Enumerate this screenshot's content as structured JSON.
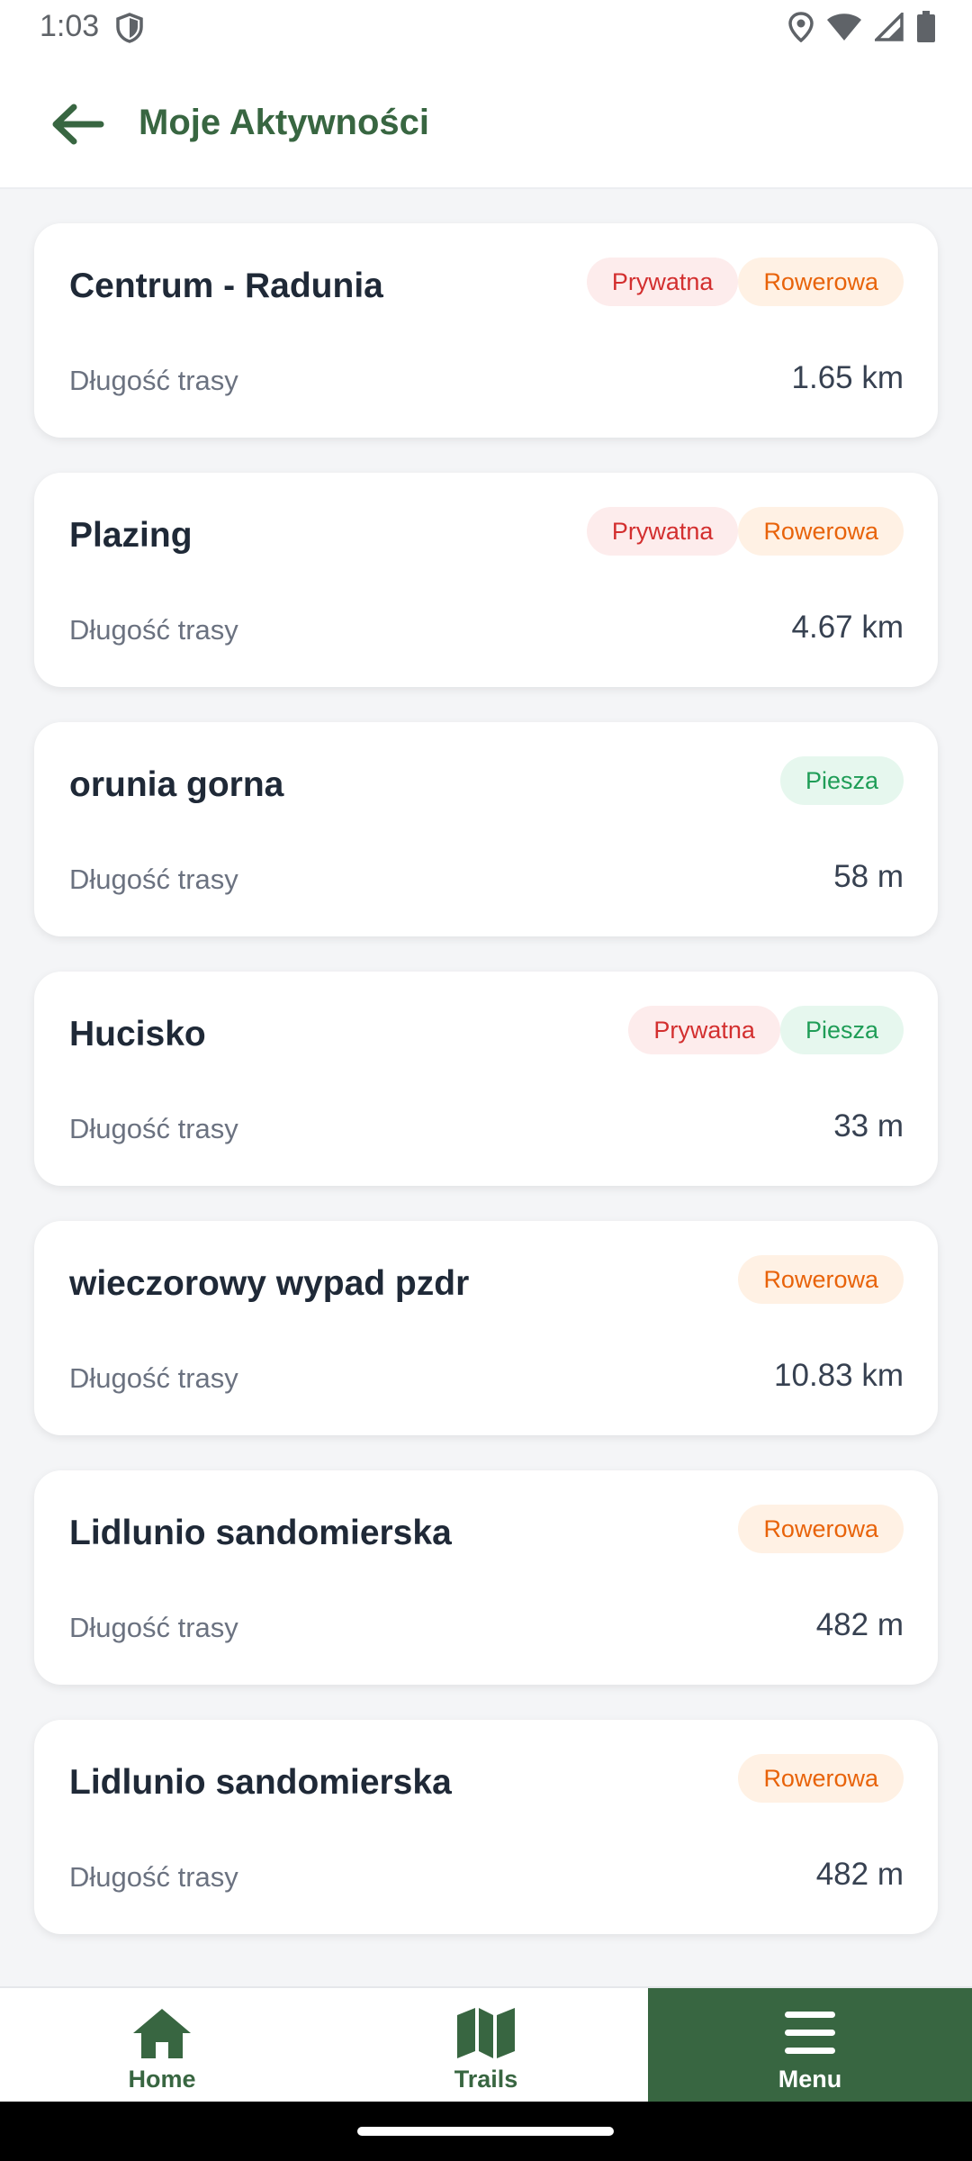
{
  "status_bar": {
    "time": "1:03",
    "icons": [
      "shield-icon",
      "location-icon",
      "wifi-icon",
      "signal-icon",
      "battery-icon"
    ]
  },
  "app_bar": {
    "back_icon": "arrow-left-icon",
    "title": "Moje Aktywności"
  },
  "colors": {
    "primary": "#386641",
    "private_text": "#d32f2f",
    "private_bg": "#fdecec",
    "bike_text": "#e8630a",
    "bike_bg": "#fff1e4",
    "walk_text": "#1f9d57",
    "walk_bg": "#e6f7ee"
  },
  "activities": [
    {
      "name": "Centrum - Radunia",
      "badges": [
        "Prywatna",
        "Rowerowa"
      ],
      "length_label": "Długość trasy",
      "length": "1.65 km"
    },
    {
      "name": "Plazing",
      "badges": [
        "Prywatna",
        "Rowerowa"
      ],
      "length_label": "Długość trasy",
      "length": "4.67 km"
    },
    {
      "name": "orunia gorna",
      "badges": [
        "Piesza"
      ],
      "length_label": "Długość trasy",
      "length": "58 m"
    },
    {
      "name": "Hucisko",
      "badges": [
        "Prywatna",
        "Piesza"
      ],
      "length_label": "Długość trasy",
      "length": "33 m"
    },
    {
      "name": "wieczorowy wypad pzdr",
      "badges": [
        "Rowerowa"
      ],
      "length_label": "Długość trasy",
      "length": "10.83 km"
    },
    {
      "name": "Lidlunio sandomierska",
      "badges": [
        "Rowerowa"
      ],
      "length_label": "Długość trasy",
      "length": "482 m"
    },
    {
      "name": "Lidlunio sandomierska",
      "badges": [
        "Rowerowa"
      ],
      "length_label": "Długość trasy",
      "length": "482 m"
    }
  ],
  "bottom_nav": [
    {
      "label": "Home",
      "icon": "home-icon",
      "active": false
    },
    {
      "label": "Trails",
      "icon": "map-icon",
      "active": false
    },
    {
      "label": "Menu",
      "icon": "menu-icon",
      "active": true
    }
  ]
}
